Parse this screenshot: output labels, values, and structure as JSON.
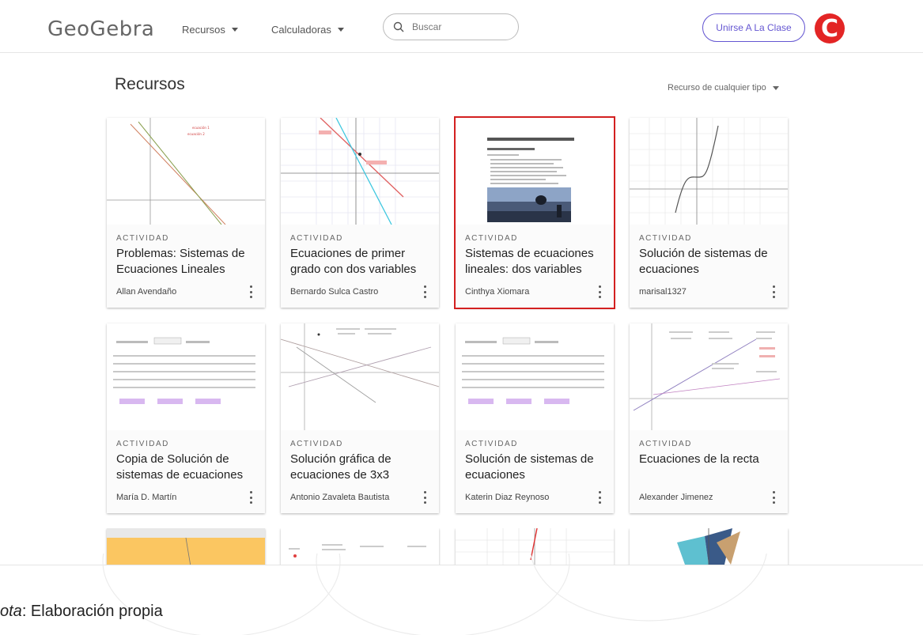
{
  "header": {
    "logo": "GeoGebra",
    "nav": [
      {
        "label": "Recursos"
      },
      {
        "label": "Calculadoras"
      }
    ],
    "search": {
      "placeholder": "Buscar"
    },
    "join_button": "Unirse A La Clase",
    "avatar_letter": "C"
  },
  "section": {
    "title": "Recursos",
    "filter": "Recurso de cualquier tipo"
  },
  "cards": [
    {
      "type": "ACTIVIDAD",
      "title": "Problemas: Sistemas de Ecuaciones Lineales",
      "author": "Allan Avendaño"
    },
    {
      "type": "ACTIVIDAD",
      "title": "Ecuaciones de primer grado con dos variables",
      "author": "Bernardo Sulca Castro"
    },
    {
      "type": "ACTIVIDAD",
      "title": "Sistemas de ecuaciones lineales: dos variables",
      "author": "Cinthya Xiomara",
      "selected": true
    },
    {
      "type": "ACTIVIDAD",
      "title": "Solución de sistemas de ecuaciones",
      "author": "marisal1327"
    },
    {
      "type": "ACTIVIDAD",
      "title": "Copia de Solución de sistemas de ecuaciones",
      "author": "María D. Martín"
    },
    {
      "type": "ACTIVIDAD",
      "title": "Solución gráfica de ecuaciones de 3x3",
      "author": "Antonio Zavaleta Bautista"
    },
    {
      "type": "ACTIVIDAD",
      "title": "Solución de sistemas de ecuaciones",
      "author": "Katerin Diaz Reynoso"
    },
    {
      "type": "ACTIVIDAD",
      "title": "Ecuaciones de la recta",
      "author": "Alexander Jimenez"
    }
  ],
  "caption": {
    "prefix": "ota",
    "text": ": Elaboración propia"
  },
  "colors": {
    "accent": "#6557d2",
    "avatar": "#e32525",
    "selected_outline": "#d32020"
  }
}
